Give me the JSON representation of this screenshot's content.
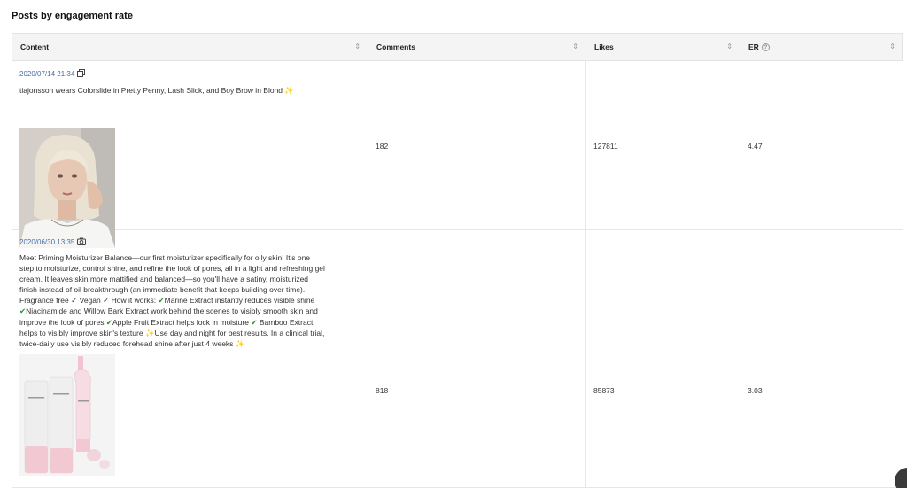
{
  "title": "Posts by engagement rate",
  "columns": {
    "content": "Content",
    "comments": "Comments",
    "likes": "Likes",
    "er": "ER",
    "help": "?",
    "sort": "⇕"
  },
  "rows": [
    {
      "date": "2020/07/14 21:34",
      "type_icon": "carousel-icon",
      "caption": "tiajonsson wears Colorslide in Pretty Penny, Lash Slick, and Boy Brow in Blond",
      "comments": "182",
      "likes": "127811",
      "er": "4.47"
    },
    {
      "date": "2020/06/30 13:35",
      "type_icon": "camera-icon",
      "caption_lines": [
        "Meet Priming Moisturizer Balance—our first moisturizer specifically for oily skin! It's one",
        "step to moisturize, control shine, and refine the look of pores, all in a light and refreshing gel",
        "cream. It leaves skin more mattified and balanced—so you'll have a satiny, moisturized",
        "finish instead of oil breakthrough (an immediate benefit that keeps building over time).",
        "Fragrance free",
        "Vegan",
        "How it works:",
        "Marine Extract instantly reduces visible shine",
        "Niacinamide and Willow Bark Extract work behind the scenes to visibly smooth skin and",
        "improve the look of pores",
        "Apple Fruit Extract helps lock in moisture",
        "Bamboo Extract",
        "helps to visibly improve skin's texture",
        "Use day and night for best results. In a clinical trial,",
        "twice-daily use visibly reduced forehead shine after just 4 weeks"
      ],
      "comments": "818",
      "likes": "85873",
      "er": "3.03"
    }
  ],
  "glyphs": {
    "sparkle": "✨",
    "check": "✔",
    "tick": "✓"
  },
  "colors": {
    "date_link": "#4a6fa5",
    "header_bg": "#f4f4f4",
    "check": "#2e8b3a"
  }
}
